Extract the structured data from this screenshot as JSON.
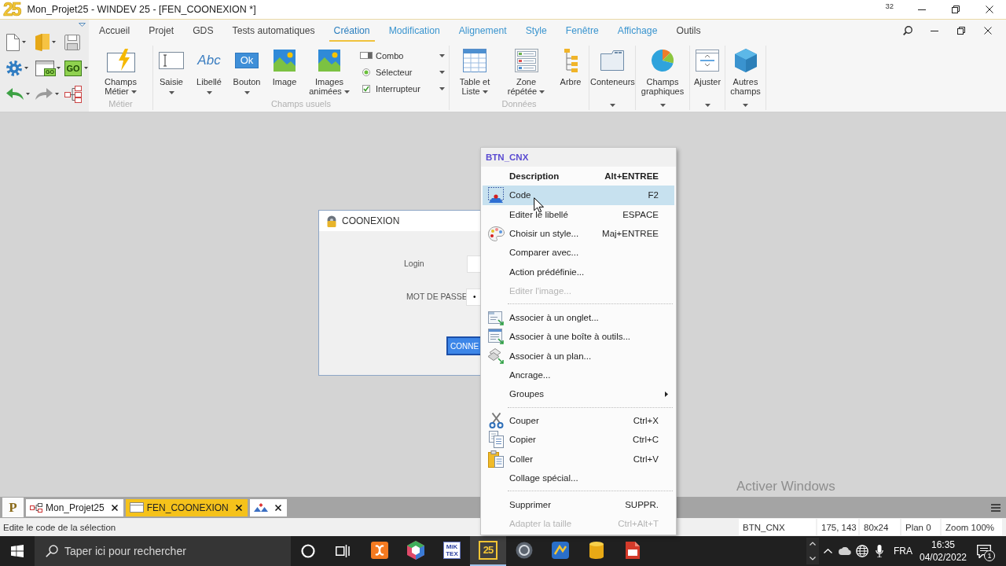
{
  "title_bar": {
    "logo": "25",
    "title": "Mon_Projet25 - WINDEV 25 - [FEN_COONEXION *]",
    "badge": "32"
  },
  "quick_access": {
    "buttons": [
      {
        "dropdown": true
      },
      {
        "dropdown": true
      },
      {
        "dropdown": false
      },
      {
        "dropdown": true
      },
      {
        "glyph": "GO",
        "dropdown": true
      },
      {
        "glyph": "GO",
        "dropdown": true
      },
      {
        "dropdown": true
      },
      {
        "dropdown": true
      },
      {
        "dropdown": false
      }
    ]
  },
  "ribbon": {
    "tabs": [
      {
        "label": "Accueil",
        "contextual": false,
        "selected": false
      },
      {
        "label": "Projet",
        "contextual": false,
        "selected": false
      },
      {
        "label": "GDS",
        "contextual": false,
        "selected": false
      },
      {
        "label": "Tests automatiques",
        "contextual": false,
        "selected": false
      },
      {
        "label": "Création",
        "contextual": true,
        "selected": true
      },
      {
        "label": "Modification",
        "contextual": true,
        "selected": false
      },
      {
        "label": "Alignement",
        "contextual": true,
        "selected": false
      },
      {
        "label": "Style",
        "contextual": true,
        "selected": false
      },
      {
        "label": "Fenêtre",
        "contextual": true,
        "selected": false
      },
      {
        "label": "Affichage",
        "contextual": true,
        "selected": false
      },
      {
        "label": "Outils",
        "contextual": false,
        "selected": false
      }
    ],
    "groups": [
      {
        "label": "Métier",
        "items": [
          {
            "kind": "large",
            "label": "Champs Métier",
            "dropdown": true
          }
        ]
      },
      {
        "label": "Champs usuels",
        "items": [
          {
            "kind": "split",
            "label": "Saisie",
            "dropdown": true
          },
          {
            "kind": "split",
            "label": "Libellé",
            "glyph": "Abc",
            "dropdown": true
          },
          {
            "kind": "split",
            "label": "Bouton",
            "glyph": "Ok",
            "dropdown": true
          },
          {
            "kind": "large",
            "label": "Image",
            "dropdown": false
          },
          {
            "kind": "large",
            "label": "Images animées",
            "dropdown": true
          },
          {
            "kind": "small",
            "label": "Combo",
            "dropdown": true
          },
          {
            "kind": "small",
            "label": "Sélecteur",
            "dropdown": true
          },
          {
            "kind": "small",
            "label": "Interrupteur",
            "dropdown": true
          }
        ]
      },
      {
        "label": "Données",
        "items": [
          {
            "kind": "large",
            "label": "Table et Liste",
            "dropdown": true
          },
          {
            "kind": "large",
            "label": "Zone répétée",
            "dropdown": true
          },
          {
            "kind": "large",
            "label": "Arbre",
            "dropdown": false
          }
        ]
      },
      {
        "items": [
          {
            "kind": "gallery",
            "label": "Conteneurs",
            "dropdown": true
          }
        ]
      },
      {
        "items": [
          {
            "kind": "gallery",
            "label": "Champs graphiques",
            "dropdown": true
          }
        ]
      },
      {
        "items": [
          {
            "kind": "gallery",
            "label": "Ajuster",
            "dropdown": true
          }
        ]
      },
      {
        "items": [
          {
            "kind": "gallery",
            "label": "Autres champs",
            "dropdown": true
          }
        ]
      }
    ]
  },
  "window": {
    "title": "COONEXION",
    "fields": [
      {
        "label": "Login"
      },
      {
        "label": "MOT DE PASSE",
        "value": "•"
      }
    ],
    "button": {
      "label": "CONNE",
      "selected": true
    }
  },
  "context_menu": {
    "title": "BTN_CNX",
    "items": [
      {
        "kind": "command",
        "label": "Description",
        "shortcut": "Alt+ENTREE",
        "default": true,
        "selected": false,
        "disabled": false
      },
      {
        "kind": "command",
        "label": "Code",
        "shortcut": "F2",
        "default": false,
        "selected": true,
        "disabled": false
      },
      {
        "kind": "command",
        "label": "Editer le libellé",
        "shortcut": "ESPACE",
        "default": false,
        "selected": false,
        "disabled": false
      },
      {
        "kind": "command",
        "label": "Choisir un style...",
        "shortcut": "Maj+ENTREE",
        "default": false,
        "selected": false,
        "disabled": false
      },
      {
        "kind": "command",
        "label": "Comparer avec...",
        "default": false,
        "selected": false,
        "disabled": false
      },
      {
        "kind": "command",
        "label": "Action prédéfinie...",
        "default": false,
        "selected": false,
        "disabled": false
      },
      {
        "kind": "command",
        "label": "Editer l'image...",
        "default": false,
        "selected": false,
        "disabled": true
      },
      {
        "kind": "separator"
      },
      {
        "kind": "command",
        "label": "Associer à un onglet...",
        "default": false,
        "selected": false,
        "disabled": false
      },
      {
        "kind": "command",
        "label": "Associer à une boîte à outils...",
        "default": false,
        "selected": false,
        "disabled": false
      },
      {
        "kind": "command",
        "label": "Associer à un plan...",
        "default": false,
        "selected": false,
        "disabled": false
      },
      {
        "kind": "command",
        "label": "Ancrage...",
        "default": false,
        "selected": false,
        "disabled": false
      },
      {
        "kind": "submenu",
        "label": "Groupes",
        "default": false,
        "selected": false,
        "disabled": false
      },
      {
        "kind": "separator"
      },
      {
        "kind": "command",
        "label": "Couper",
        "shortcut": "Ctrl+X",
        "default": false,
        "selected": false,
        "disabled": false
      },
      {
        "kind": "command",
        "label": "Copier",
        "shortcut": "Ctrl+C",
        "default": false,
        "selected": false,
        "disabled": false
      },
      {
        "kind": "command",
        "label": "Coller",
        "shortcut": "Ctrl+V",
        "default": false,
        "selected": false,
        "disabled": false
      },
      {
        "kind": "command",
        "label": "Collage spécial...",
        "default": false,
        "selected": false,
        "disabled": false
      },
      {
        "kind": "separator"
      },
      {
        "kind": "command",
        "label": "Supprimer",
        "shortcut": "SUPPR.",
        "default": false,
        "selected": false,
        "disabled": false
      },
      {
        "kind": "command",
        "label": "Adapter la taille",
        "shortcut": "Ctrl+Alt+T",
        "default": false,
        "selected": false,
        "disabled": true
      }
    ]
  },
  "document_tabs": {
    "home": "P",
    "tabs": [
      {
        "label": "Mon_Projet25",
        "selected": false
      },
      {
        "label": "FEN_COONEXION",
        "selected": true
      },
      {
        "selected": false
      }
    ]
  },
  "os_notice": "Activer Windows",
  "status_bar": {
    "message": "Edite le code de la sélection",
    "panels": [
      "BTN_CNX",
      "175, 143",
      "80x24",
      "Plan 0",
      "Zoom 100%"
    ]
  },
  "taskbar": {
    "search": {
      "placeholder": "Taper ici pour rechercher"
    },
    "apps": [
      {
        "selected": false
      },
      {
        "selected": false
      },
      {
        "label": "MiK TEX",
        "selected": false
      },
      {
        "label": "25",
        "selected": true
      },
      {
        "selected": false
      },
      {
        "selected": false
      },
      {
        "selected": false
      },
      {
        "selected": false
      }
    ],
    "tray": {
      "language": "FRA",
      "time": "16:35",
      "date": "04/02/2022",
      "notifications": "1"
    }
  }
}
